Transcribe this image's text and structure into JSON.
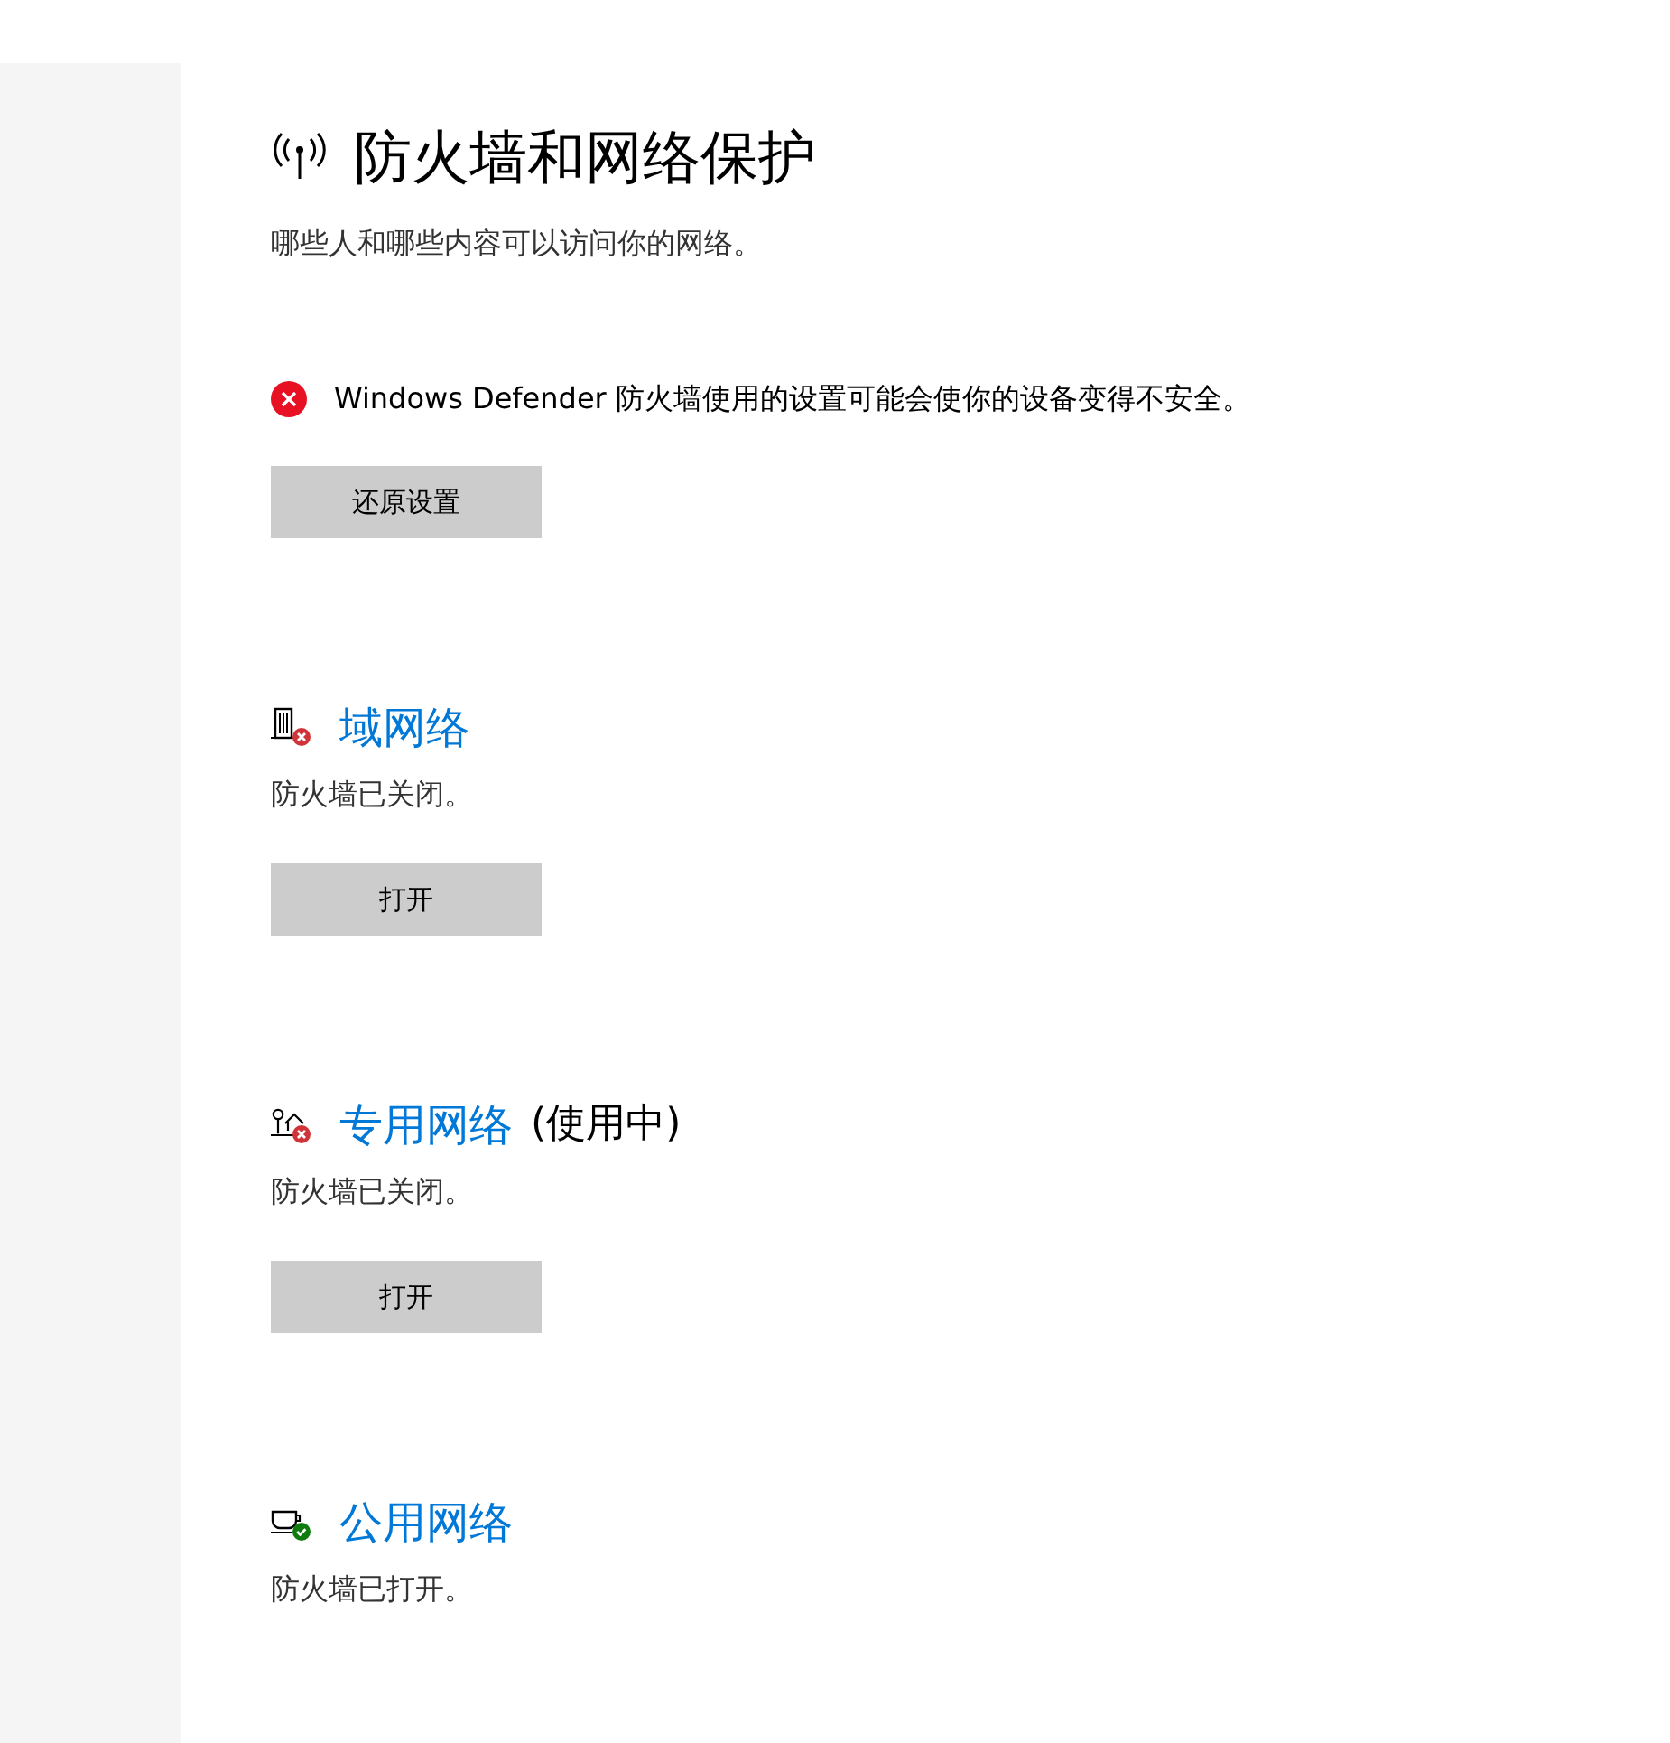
{
  "page": {
    "title": "防火墙和网络保护",
    "subtitle": "哪些人和哪些内容可以访问你的网络。"
  },
  "alert": {
    "kind": "error",
    "text": "Windows Defender 防火墙使用的设置可能会使你的设备变得不安全。",
    "button": "还原设置"
  },
  "networks": [
    {
      "kind": "domain",
      "name": "域网络",
      "status": "防火墙已关闭。",
      "firewall_on": false,
      "button": "打开"
    },
    {
      "kind": "private",
      "name": "专用网络",
      "suffix": "(使用中)",
      "status": "防火墙已关闭。",
      "firewall_on": false,
      "button": "打开"
    },
    {
      "kind": "public",
      "name": "公用网络",
      "status": "防火墙已打开。",
      "firewall_on": true
    }
  ]
}
